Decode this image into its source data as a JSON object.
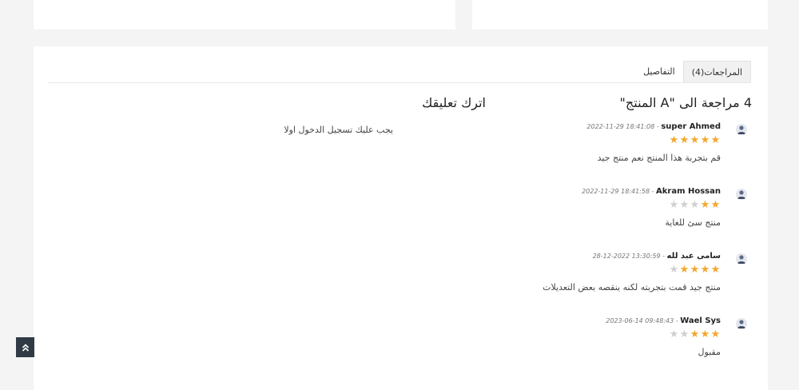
{
  "tabs": [
    {
      "label": "التفاصيل"
    },
    {
      "label": "المراجعات(4)"
    }
  ],
  "reviews_heading": "4 مراجعة الى \"A المنتج\"",
  "comment_heading": "اترك تعليقك",
  "login_note": "يجب عليك تسجيل الدخول اولا",
  "date_separator": " - ",
  "reviews": [
    {
      "name": "super Ahmed",
      "date": "2022-11-29 18:41:08",
      "rating": 5,
      "text": "قم بتجربة هذا المنتج نعم منتج جيد"
    },
    {
      "name": "Akram Hossan",
      "date": "2022-11-29 18:41:58",
      "rating": 2,
      "text": "منتج سئ للغاية"
    },
    {
      "name": "سامى عبد لله",
      "date": "28-12-2022 13:30:59",
      "rating": 4,
      "text": "منتج جيد قمت بتجربته لكنه ينقصه بعض التعديلات"
    },
    {
      "name": "Wael Sys",
      "date": "2023-06-14 09:48:43",
      "rating": 3,
      "text": "مقبول"
    }
  ],
  "colors": {
    "star_on": "#f3a72c",
    "star_off": "#cfcfcf",
    "scroll_button": "#2f3a45"
  },
  "icons": {
    "avatar": "user-avatar-icon",
    "star": "star-icon",
    "scroll_top": "double-chevron-up-icon"
  }
}
